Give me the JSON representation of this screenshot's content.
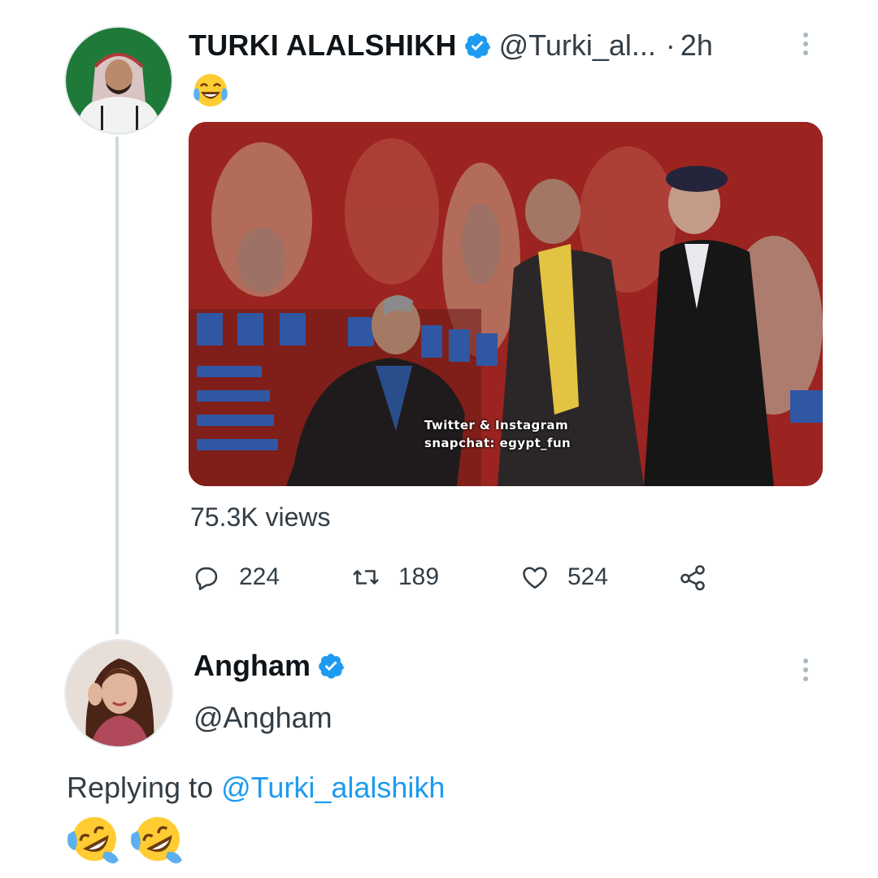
{
  "tweet": {
    "author_name": "TURKI ALALSHIKH",
    "handle": "@Turki_al...",
    "separator": "·",
    "time": "2h",
    "text_emoji": "face-with-tears-of-joy",
    "video_watermark_line1": "Twitter & Instagram",
    "video_watermark_line2": "snapchat: egypt_fun",
    "views": "75.3K views",
    "actions": {
      "reply_count": "224",
      "retweet_count": "189",
      "like_count": "524"
    }
  },
  "reply": {
    "author_name": "Angham",
    "handle": "@Angham",
    "replying_prefix": "Replying to",
    "replying_handle": "@Turki_alalshikh",
    "text_emojis": [
      "rolling-on-the-floor-laughing",
      "rolling-on-the-floor-laughing"
    ]
  },
  "colors": {
    "verified_blue": "#1d9bf0",
    "link_blue": "#1d9bf0",
    "secondary_text": "#536471",
    "thread_line": "#cfd9de"
  },
  "icons": {
    "verified": "verified-badge-icon",
    "more": "more-vertical-icon",
    "reply": "comment-bubble-icon",
    "retweet": "retweet-icon",
    "like": "heart-icon",
    "share": "share-nodes-icon"
  }
}
